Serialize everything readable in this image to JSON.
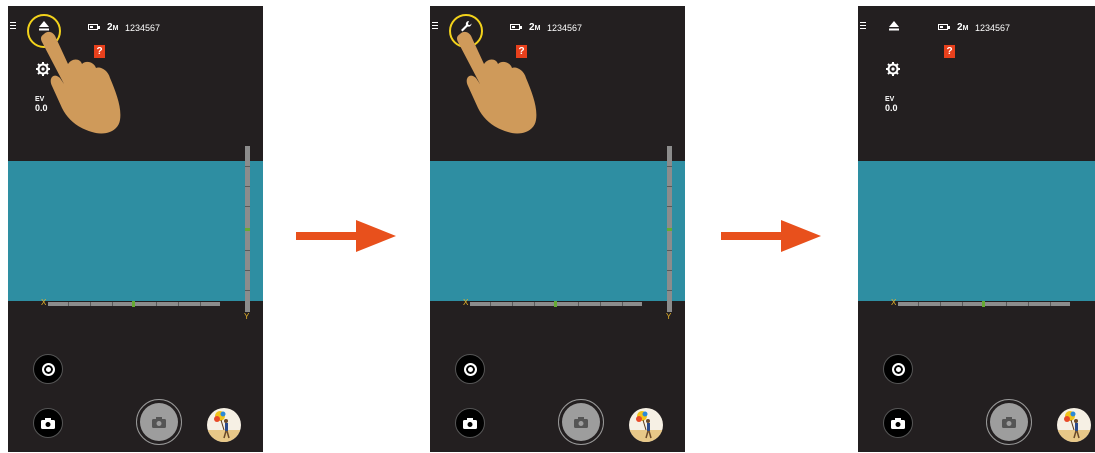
{
  "screens": [
    {
      "top_left_icon": "eject-icon",
      "highlight": true,
      "hand": true,
      "resolution": "2",
      "resolution_unit": "M",
      "counter": "1234567",
      "warn": "?",
      "ev_label": "EV",
      "ev_value": "0.0",
      "x_label": "X",
      "y_label": "Y",
      "level_scale": true
    },
    {
      "top_left_icon": "wrench-icon",
      "highlight": true,
      "hand": true,
      "resolution": "2",
      "resolution_unit": "M",
      "counter": "1234567",
      "warn": "?",
      "x_label": "X",
      "y_label": "Y",
      "level_scale": true
    },
    {
      "top_left_icon": "eject-icon",
      "highlight": false,
      "hand": false,
      "resolution": "2",
      "resolution_unit": "M",
      "counter": "1234567",
      "warn": "?",
      "ev_label": "EV",
      "ev_value": "0.0",
      "x_label": "X",
      "level_scale": false
    }
  ],
  "colors": {
    "phone_bg": "#231f20",
    "viewfinder": "#2e8ea2",
    "highlight_ring": "#f2d21b",
    "arrow": "#e8501c",
    "warning": "#e8401c",
    "axis_label": "#e8b428"
  }
}
